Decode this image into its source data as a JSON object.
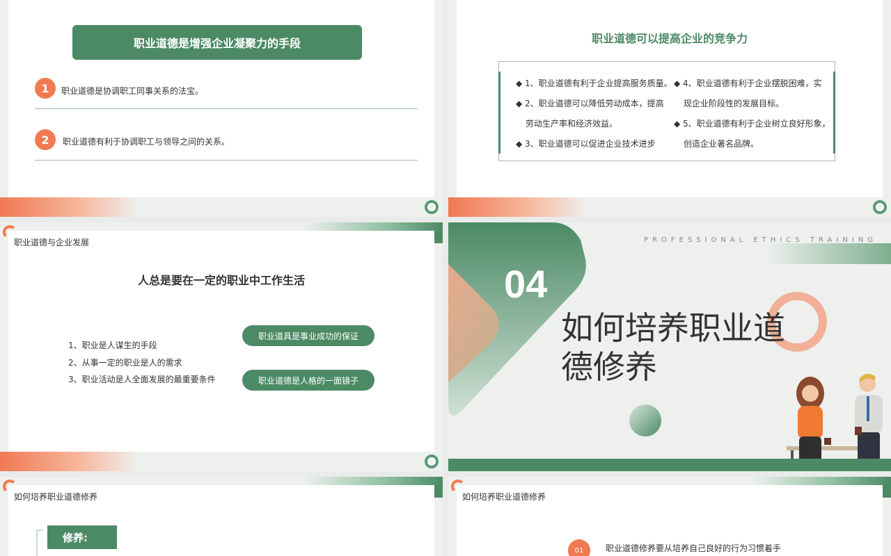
{
  "slide1": {
    "banner": "职业道德是增强企业凝聚力的手段",
    "items": [
      {
        "num": "1",
        "text": "职业道德是协调职工同事关系的法宝。"
      },
      {
        "num": "2",
        "text": "职业道德有利于协调职工与领导之间的关系。"
      }
    ]
  },
  "slide2": {
    "title": "职业道德可以提高企业的竞争力",
    "lines": [
      "◆ 1、职业道德有利于企业提高服务质量。",
      "◆ 2、职业道德可以降低劳动成本，提高",
      "劳动生产率和经济效益。",
      "◆ 3、职业道德可以促进企业技术进步",
      "◆ 4、职业道德有利于企业摆脱困难，实",
      "现企业阶段性的发展目标。",
      "◆ 5、职业道德有利于企业树立良好形象，",
      "创造企业著名品牌。"
    ]
  },
  "slide3": {
    "header": "职业道德与企业发展",
    "title": "人总是要在一定的职业中工作生活",
    "list": [
      "1、职业是人谋生的手段",
      "2、从事一定的职业是人的需求",
      "3、职业活动是人全面发展的最重要条件"
    ],
    "pills": [
      "职业道具是事业成功的保证",
      "职业道德是人格的一面镜子"
    ]
  },
  "slide4": {
    "english": "PROFESSIONAL ETHICS TRAINING",
    "number": "04",
    "title": "如何培养职业道德修养"
  },
  "slide5": {
    "header": "如何培养职业道德修养",
    "box": "修养:"
  },
  "slide6": {
    "header": "如何培养职业道德修养",
    "num": "01",
    "text": "职业道德修养要从培养自己良好的行为习惯着手"
  },
  "colors": {
    "green": "#4c8a66",
    "orange": "#f07a52",
    "bg": "#eef0ee"
  }
}
